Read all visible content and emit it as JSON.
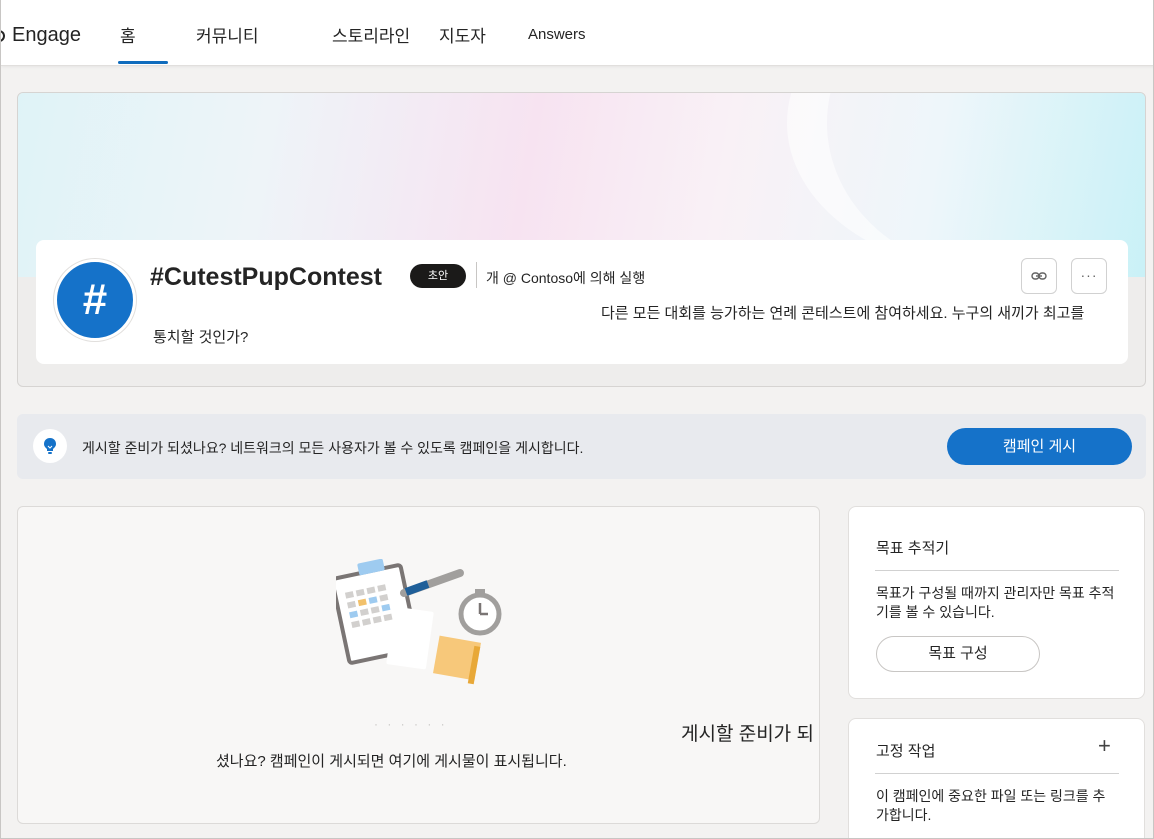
{
  "topnav": {
    "brand": "Engage",
    "tabs": [
      {
        "label": "홈",
        "active": true
      },
      {
        "label": "커뮤니티"
      },
      {
        "label": "스토리라인"
      },
      {
        "label": "지도자"
      },
      {
        "label": "Answers"
      }
    ]
  },
  "campaign": {
    "icon_glyph": "#",
    "title": "#CutestPupContest",
    "status_badge": "초안",
    "run_by": "개 @ Contoso에 의해 실행",
    "link_icon": "link-icon",
    "more_icon": "more-icon",
    "description_line1": "다른 모든 대회를 능가하는 연례 콘테스트에 참여하세요. 누구의 새끼가 최고를",
    "description_line2": "통치할 것인가?"
  },
  "publish_banner": {
    "icon": "lightbulb-icon",
    "text": "게시할 준비가 되셨나요? 네트워크의 모든 사용자가 볼 수 있도록 캠페인을 게시합니다.",
    "button_label": "캠페인 게시"
  },
  "feed": {
    "empty_text_part1": "게시할 준비가 되",
    "empty_text_part2": "셨나요? 캠페인이 게시되면 여기에 게시물이 표시됩니다."
  },
  "goal_tracker": {
    "title": "목표 추적기",
    "body": "목표가 구성될 때까지 관리자만 목표 추적기를 볼 수 있습니다.",
    "button_label": "목표 구성"
  },
  "pinned": {
    "title": "고정 작업",
    "add_icon": "plus-icon",
    "body": "이 캠페인에 중요한 파일 또는 링크를 추가합니다."
  },
  "colors": {
    "accent": "#1572c9",
    "nav_underline": "#0f6cbd",
    "badge_bg": "#1b1a19"
  }
}
